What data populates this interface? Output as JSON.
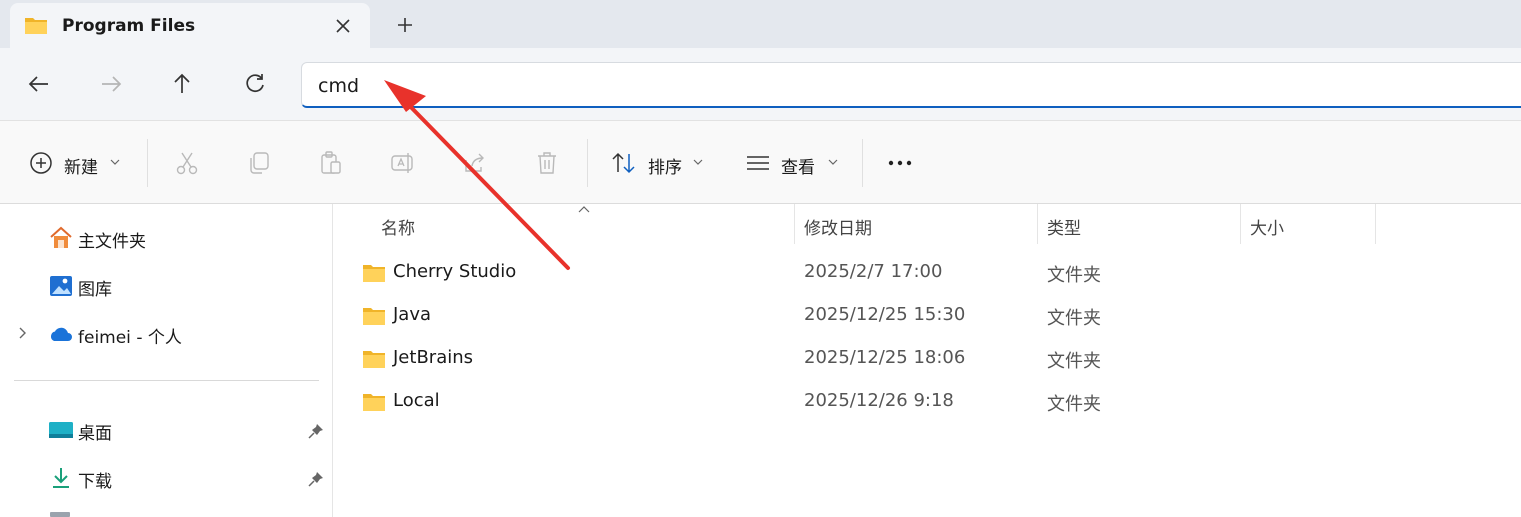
{
  "tab": {
    "title": "Program Files"
  },
  "address": {
    "value": "cmd"
  },
  "commands": {
    "new_label": "新建",
    "sort_label": "排序",
    "view_label": "查看"
  },
  "sidebar": {
    "items": [
      {
        "label": "主文件夹",
        "icon": "home-icon"
      },
      {
        "label": "图库",
        "icon": "gallery-icon"
      },
      {
        "label": "feimei - 个人",
        "icon": "onedrive-cloud-icon"
      },
      {
        "label": "桌面",
        "icon": "desktop-icon"
      },
      {
        "label": "下载",
        "icon": "download-icon"
      }
    ]
  },
  "columns": {
    "name": "名称",
    "modified": "修改日期",
    "type": "类型",
    "size": "大小"
  },
  "files": [
    {
      "name": "Cherry Studio",
      "modified": "2025/2/7 17:00",
      "type": "文件夹"
    },
    {
      "name": "Java",
      "modified": "2025/12/25 15:30",
      "type": "文件夹"
    },
    {
      "name": "JetBrains",
      "modified": "2025/12/25 18:06",
      "type": "文件夹"
    },
    {
      "name": "Local",
      "modified": "2025/12/26 9:18",
      "type": "文件夹"
    }
  ],
  "colors": {
    "accent": "#0f5fbf",
    "folder": "#f5c542",
    "annotation_arrow": "#e8322b"
  }
}
